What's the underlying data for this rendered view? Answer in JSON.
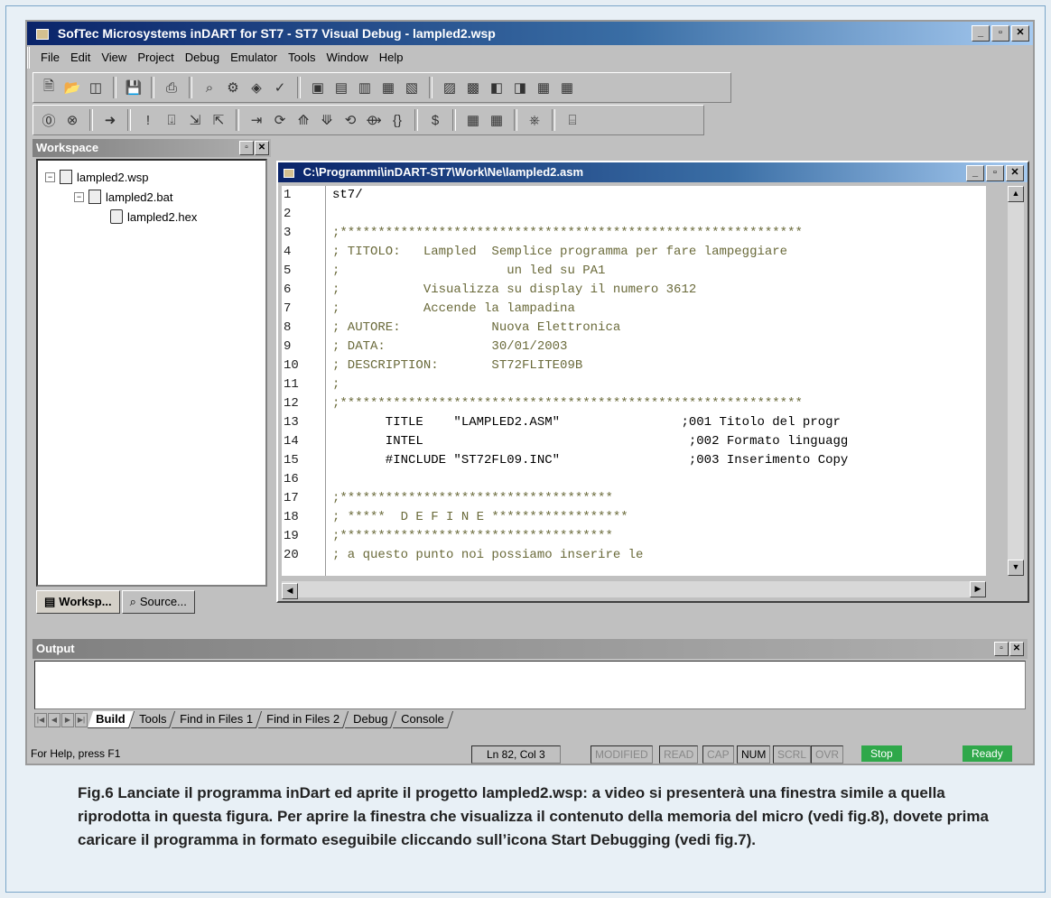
{
  "window": {
    "title": "SofTec Microsystems inDART for ST7 - ST7 Visual Debug - lampled2.wsp",
    "minimize_label": "_",
    "maximize_label": "▫",
    "close_label": "✕"
  },
  "menubar": [
    {
      "label": "File"
    },
    {
      "label": "Edit"
    },
    {
      "label": "View"
    },
    {
      "label": "Project"
    },
    {
      "label": "Debug"
    },
    {
      "label": "Emulator"
    },
    {
      "label": "Tools"
    },
    {
      "label": "Window"
    },
    {
      "label": "Help"
    }
  ],
  "workspace": {
    "title": "Workspace",
    "tree": [
      {
        "label": "lampled2.wsp",
        "icon": "workspace-icon"
      },
      {
        "label": "lampled2.bat",
        "icon": "batch-file-icon"
      },
      {
        "label": "lampled2.hex",
        "icon": "hex-file-icon"
      }
    ],
    "tabs": [
      {
        "label": "Worksp..."
      },
      {
        "label": "Source..."
      }
    ]
  },
  "editor": {
    "title": "C:\\Programmi\\inDART-ST7\\Work\\Ne\\lampled2.asm",
    "line_numbers": [
      "1",
      "2",
      "3",
      "4",
      "5",
      "6",
      "7",
      "8",
      "9",
      "10",
      "11",
      "12",
      "13",
      "14",
      "15",
      "16",
      "17",
      "18",
      "19",
      "20"
    ],
    "lines": [
      "st7/",
      "",
      ";*************************************************************",
      "; TITOLO:   Lampled  Semplice programma per fare lampeggiare",
      ";                      un led su PA1",
      ";           Visualizza su display il numero 3612",
      ";           Accende la lampadina",
      "; AUTORE:            Nuova Elettronica",
      "; DATA:              30/01/2003",
      "; DESCRIPTION:       ST72FLITE09B",
      ";",
      ";*************************************************************",
      "       TITLE    \"LAMPLED2.ASM\"                ;001 Titolo del progr",
      "       INTEL                                   ;002 Formato linguagg",
      "       #INCLUDE \"ST72FL09.INC\"                 ;003 Inserimento Copy",
      "",
      ";************************************",
      "; *****  D E F I N E ******************",
      ";************************************",
      "; a questo punto noi possiamo inserire le"
    ]
  },
  "output": {
    "title": "Output",
    "tabs": [
      "Build",
      "Tools",
      "Find in Files 1",
      "Find in Files 2",
      "Debug",
      "Console"
    ],
    "active_tab": "Build"
  },
  "statusbar": {
    "help": "For Help, press F1",
    "position": "Ln 82, Col 3",
    "flags": [
      {
        "label": "MODIFIED",
        "active": false
      },
      {
        "label": "READ",
        "active": false
      },
      {
        "label": "CAP",
        "active": false
      },
      {
        "label": "NUM",
        "active": true
      },
      {
        "label": "SCRL",
        "active": false
      },
      {
        "label": "OVR",
        "active": false
      }
    ],
    "stop": "Stop",
    "ready": "Ready",
    "status_color": "#2fa84a"
  },
  "caption": "Fig.6 Lanciate il programma inDart ed aprite il progetto lampled2.wsp: a video si presenterà una finestra simile a quella riprodotta in questa figura. Per aprire la finestra che visualizza il contenuto della memoria del micro (vedi fig.8), dovete prima caricare il programma in formato eseguibile cliccando sull’icona Start Debugging (vedi fig.7)."
}
